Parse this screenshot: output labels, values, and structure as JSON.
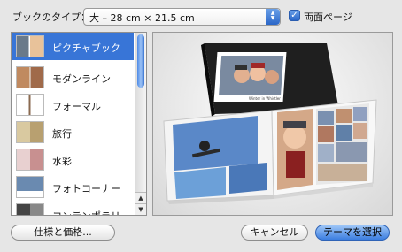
{
  "book_type": {
    "label": "ブックのタイプ：",
    "selected": "大 – 28 cm × 21.5 cm"
  },
  "double_sided": {
    "label": "両面ページ",
    "checked": true
  },
  "themes": {
    "items": [
      {
        "label": "ピクチャブック",
        "selected": true
      },
      {
        "label": "モダンライン",
        "selected": false
      },
      {
        "label": "フォーマル",
        "selected": false
      },
      {
        "label": "旅行",
        "selected": false
      },
      {
        "label": "水彩",
        "selected": false
      },
      {
        "label": "フォトコーナー",
        "selected": false
      },
      {
        "label": "コンテンポラリー",
        "selected": false
      }
    ]
  },
  "preview": {
    "caption": "Winter in Whistler"
  },
  "buttons": {
    "spec": "仕様と価格...",
    "cancel": "キャンセル",
    "choose": "テーマを選択"
  },
  "colors": {
    "selection": "#3875d7",
    "accent": "#2a66c8"
  }
}
